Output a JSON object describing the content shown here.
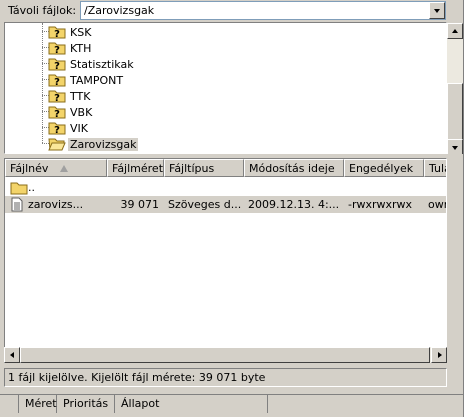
{
  "remote": {
    "label": "Távoli fájlok:",
    "path": "/Zarovizsgak"
  },
  "tree": {
    "items": [
      {
        "label": "KSK",
        "icon": "folder-unknown-icon"
      },
      {
        "label": "KTH",
        "icon": "folder-unknown-icon"
      },
      {
        "label": "Statisztikak",
        "icon": "folder-unknown-icon"
      },
      {
        "label": "TAMPONT",
        "icon": "folder-unknown-icon"
      },
      {
        "label": "TTK",
        "icon": "folder-unknown-icon"
      },
      {
        "label": "VBK",
        "icon": "folder-unknown-icon"
      },
      {
        "label": "VIK",
        "icon": "folder-unknown-icon"
      },
      {
        "label": "Zarovizsgak",
        "icon": "folder-open-icon"
      }
    ]
  },
  "list": {
    "columns": [
      "Fájlnév",
      "Fájlméret",
      "Fájltípus",
      "Módosítás ideje",
      "Engedélyek",
      "Tula"
    ],
    "rows": [
      {
        "name": "..",
        "size": "",
        "type": "",
        "modified": "",
        "perms": "",
        "owner": "",
        "icon": "parent-folder-icon"
      },
      {
        "name": "zarovizs...",
        "size": "39 071",
        "type": "Szöveges d...",
        "modified": "2009.12.13. 4:...",
        "perms": "-rwxrwxrwx",
        "owner": "owr",
        "icon": "text-file-icon"
      }
    ]
  },
  "status": {
    "text": "1 fájl kijelölve. Kijelölt fájl mérete: 39 071 byte"
  },
  "queue": {
    "tabs": [
      "",
      "Méret",
      "Prioritás",
      "Állapot"
    ]
  },
  "colors": {
    "face": "#d4d0c8",
    "folder": "#f3d46a",
    "highlight": "#d4d0c8"
  }
}
